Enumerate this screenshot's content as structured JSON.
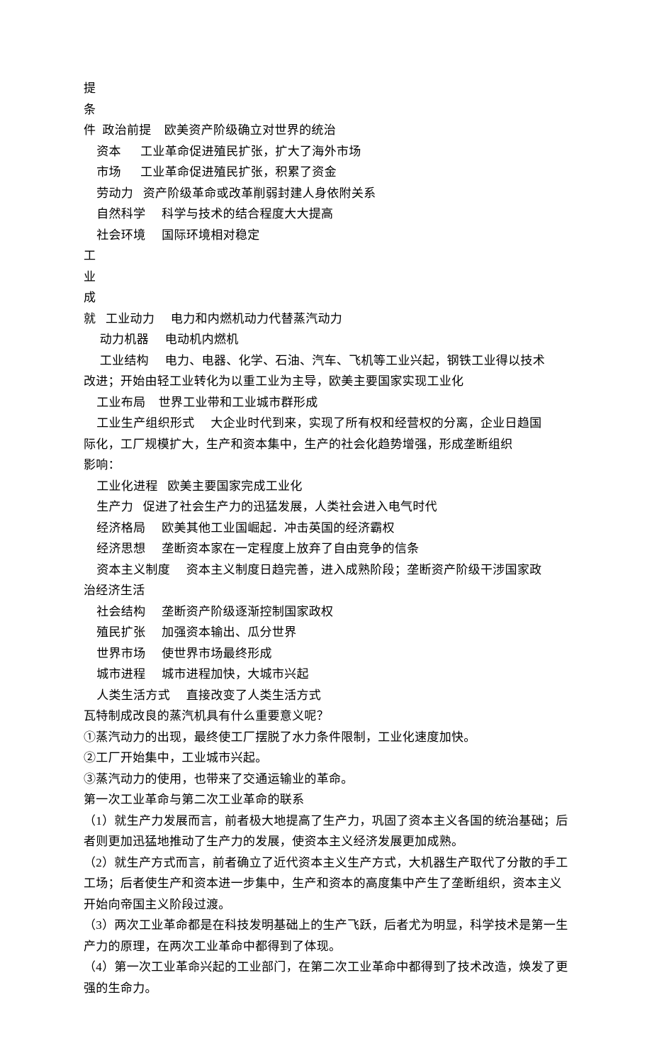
{
  "lines": [
    "提",
    "条",
    "件  政治前提    欧美资产阶级确立对世界的统治",
    "    资本      工业革命促进殖民扩张，扩大了海外市场",
    "    市场      工业革命促进殖民扩张，积累了资金",
    "    劳动力   资产阶级革命或改革削弱封建人身依附关系",
    "    自然科学     科学与技术的结合程度大大提高",
    "    社会环境     国际环境相对稳定",
    "工",
    "业",
    "成",
    "就   工业动力     电力和内燃机动力代替蒸汽动力",
    "     动力机器     电动机内燃机",
    "     工业结构     电力、电器、化学、石油、汽车、飞机等工业兴起，钢铁工业得以技术",
    "改进；开始由轻工业转化为以重工业为主导，欧美主要国家实现工业化",
    "    工业布局    世界工业带和工业城市群形成",
    "    工业生产组织形式     大企业时代到来，实现了所有权和经营权的分离，企业日趋国",
    "际化，工厂规模扩大，生产和资本集中，生产的社会化趋势增强，形成垄断组织",
    "影响：",
    "    工业化进程   欧美主要国家完成工业化",
    "    生产力   促进了社会生产力的迅猛发展，人类社会进入电气时代",
    "    经济格局     欧美其他工业国崛起．冲击英国的经济霸权",
    "    经济思想     垄断资本家在一定程度上放弃了自由竞争的信条",
    "    资本主义制度     资本主义制度日趋完善，进入成熟阶段；垄断资产阶级干涉国家政",
    "治经济生活",
    "    社会结构     垄断资产阶级逐渐控制国家政权",
    "    殖民扩张     加强资本输出、瓜分世界",
    "    世界市场     使世界市场最终形成",
    "    城市进程     城市进程加快，大城市兴起",
    "    人类生活方式     直接改变了人类生活方式",
    "瓦特制成改良的蒸汽机具有什么重要意义呢？",
    "①蒸汽动力的出现，最终使工厂摆脱了水力条件限制，工业化速度加快。",
    "②工厂开始集中，工业城市兴起。",
    "③蒸汽动力的使用，也带来了交通运输业的革命。",
    "第一次工业革命与第二次工业革命的联系",
    "（1）就生产力发展而言，前者极大地提高了生产力，巩固了资本主义各国的统治基础；后",
    "者则更加迅猛地推动了生产力的发展，使资本主义经济发展更加成熟。",
    "（2）就生产方式而言，前者确立了近代资本主义生产方式，大机器生产取代了分散的手工",
    "工场；后者使生产和资本进一步集中，生产和资本的高度集中产生了垄断组织，资本主义",
    "开始向帝国主义阶段过渡。",
    "（3）两次工业革命都是在科技发明基础上的生产飞跃，后者尤为明显，科学技术是第一生",
    "产力的原理，在两次工业革命中都得到了体现。",
    "（4）第一次工业革命兴起的工业部门，在第二次工业革命中都得到了技术改造，焕发了更",
    "强的生命力。"
  ]
}
